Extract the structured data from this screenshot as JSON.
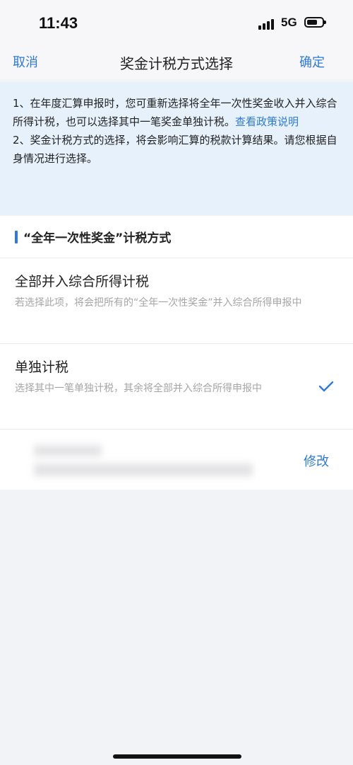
{
  "status_bar": {
    "time": "11:43",
    "network": "5G",
    "signal_icon": "signal-bars-icon",
    "battery_icon": "battery-icon"
  },
  "nav": {
    "cancel": "取消",
    "title": "奖金计税方式选择",
    "confirm": "确定"
  },
  "notice": {
    "line1_before_link": "1、在年度汇算申报时，您可重新选择将全年一次性奖金收入并入综合所得计税，也可以选择其中一笔奖金单独计税。",
    "policy_link": "查看政策说明",
    "line2": "2、奖金计税方式的选择，将会影响汇算的税款计算结果。请您根据自身情况进行选择。"
  },
  "section": {
    "title": "“全年一次性奖金”计税方式"
  },
  "options": [
    {
      "title": "全部并入综合所得计税",
      "description": "若选择此项，将会把所有的“全年一次性奖金”并入综合所得申报中",
      "selected": false
    },
    {
      "title": "单独计税",
      "description": "选择其中一笔单独计税，其余将全部并入综合所得申报中",
      "selected": true
    }
  ],
  "bonus_row": {
    "edit": "修改"
  },
  "colors": {
    "accent": "#2f7ad6",
    "notice_bg": "#e6f1fc",
    "page_bg": "#f2f3f7"
  }
}
